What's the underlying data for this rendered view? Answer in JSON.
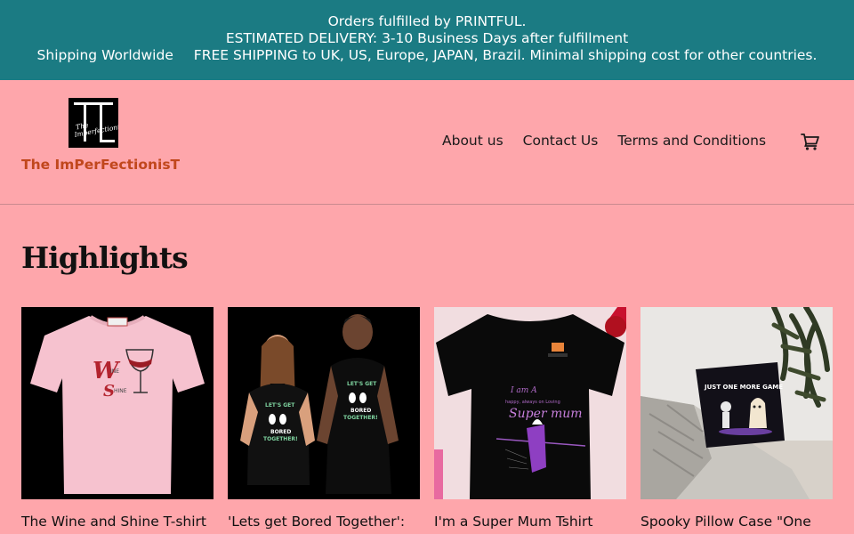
{
  "announcement": {
    "line1": "Orders fulfilled by PRINTFUL.",
    "line2": "ESTIMATED DELIVERY: 3-10 Business Days after fulfillment",
    "line3a": "Shipping Worldwide",
    "line3b": "FREE SHIPPING to UK, US, Europe, JAPAN, Brazil. Minimal shipping cost for other countries."
  },
  "brand": {
    "name": "The ImPerFectionisT",
    "logo_script": "The ImPerFectionisT"
  },
  "nav": {
    "about": "About us",
    "contact": "Contact Us",
    "terms": "Terms and Conditions"
  },
  "cart": {
    "icon": "cart-icon"
  },
  "section": {
    "title": "Highlights"
  },
  "products": [
    {
      "title": "The Wine and Shine T-shirt"
    },
    {
      "title": "'Lets get Bored Together':"
    },
    {
      "title": "I'm a Super Mum Tshirt"
    },
    {
      "title": "Spooky Pillow Case \"One"
    }
  ],
  "colors": {
    "announcement_bg": "#1b7b83",
    "page_bg": "#fea6ab",
    "brand_accent": "#c1471d"
  }
}
